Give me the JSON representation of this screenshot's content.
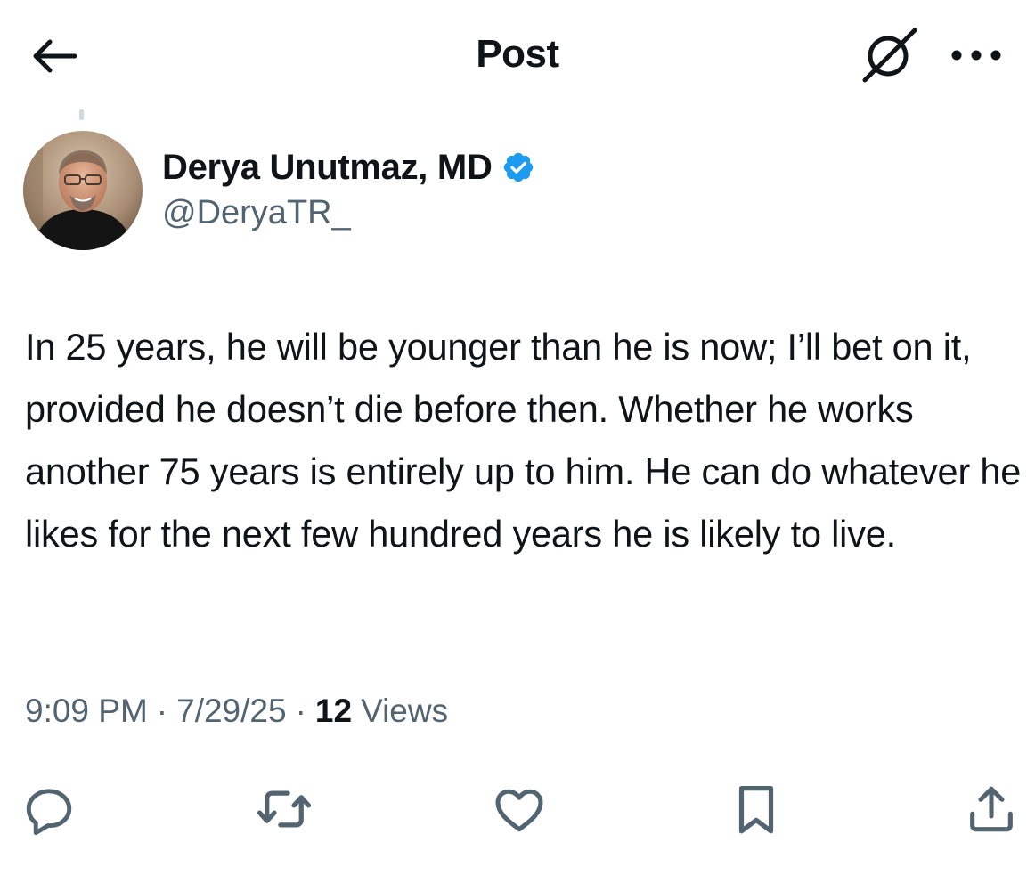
{
  "header": {
    "title": "Post",
    "back_icon": "arrow-left-icon",
    "grok_icon": "grok-icon",
    "more_icon": "more-horizontal-icon"
  },
  "author": {
    "display_name": "Derya Unutmaz, MD",
    "handle": "@DeryaTR_",
    "verified": true,
    "verified_color": "#1d9bf0"
  },
  "post": {
    "text": "In 25 years, he will be younger than he is now; I’ll bet on it, provided he doesn’t die before then. Whether he works another 75 years is entirely up to him. He can do whatever he likes for the next few hundred years he is likely to live."
  },
  "meta": {
    "time": "9:09 PM",
    "separator": "·",
    "date": "7/29/25",
    "views_count": "12",
    "views_label": "Views"
  },
  "actions": [
    {
      "name": "reply",
      "icon": "reply-icon"
    },
    {
      "name": "repost",
      "icon": "repost-icon"
    },
    {
      "name": "like",
      "icon": "heart-icon"
    },
    {
      "name": "bookmark",
      "icon": "bookmark-icon"
    },
    {
      "name": "share",
      "icon": "share-icon"
    }
  ],
  "colors": {
    "text_primary": "#0f1419",
    "text_secondary": "#536471",
    "icon": "#536471",
    "accent": "#1d9bf0"
  }
}
